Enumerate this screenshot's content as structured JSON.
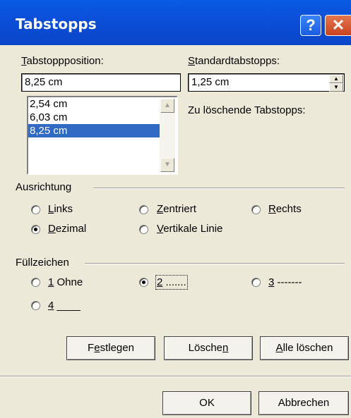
{
  "window": {
    "title": "Tabstopps",
    "help_glyph": "?",
    "close_glyph": "✕"
  },
  "tabstop_position": {
    "label_key": "T",
    "label_rest": "abstoppposition:",
    "value": "8,25 cm",
    "list": [
      "2,54 cm",
      "6,03 cm",
      "8,25 cm"
    ],
    "selected_index": 2
  },
  "default_tabs": {
    "label_key": "S",
    "label_rest": "tandardtabstopps:",
    "value": "1,25 cm"
  },
  "to_delete": {
    "label": "Zu löschende Tabstopps:"
  },
  "alignment": {
    "legend": "Ausrichtung",
    "options": [
      {
        "key": "L",
        "rest": "inks",
        "checked": false
      },
      {
        "key": "Z",
        "rest": "entriert",
        "checked": false
      },
      {
        "key": "R",
        "rest": "echts",
        "checked": false
      },
      {
        "key": "D",
        "rest": "ezimal",
        "checked": true
      },
      {
        "key": "V",
        "rest": "ertikale Linie",
        "checked": false
      }
    ]
  },
  "leader": {
    "legend": "Füllzeichen",
    "options": [
      {
        "key": "1",
        "rest": " Ohne",
        "checked": false
      },
      {
        "key": "2",
        "rest": " .......",
        "checked": true
      },
      {
        "key": "3",
        "rest": " -------",
        "checked": false
      },
      {
        "key": "4",
        "rest": " ____",
        "checked": false
      }
    ]
  },
  "buttons": {
    "set_pre": "F",
    "set_key": "e",
    "set_post": "stlegen",
    "delete_pre": "Lösche",
    "delete_key": "n",
    "delete_all_key": "A",
    "delete_all_rest": "lle löschen",
    "ok": "OK",
    "cancel": "Abbrechen"
  },
  "icons": {
    "scroll_up": "▲",
    "scroll_down": "▼",
    "spin_up": "▲",
    "spin_down": "▼"
  }
}
